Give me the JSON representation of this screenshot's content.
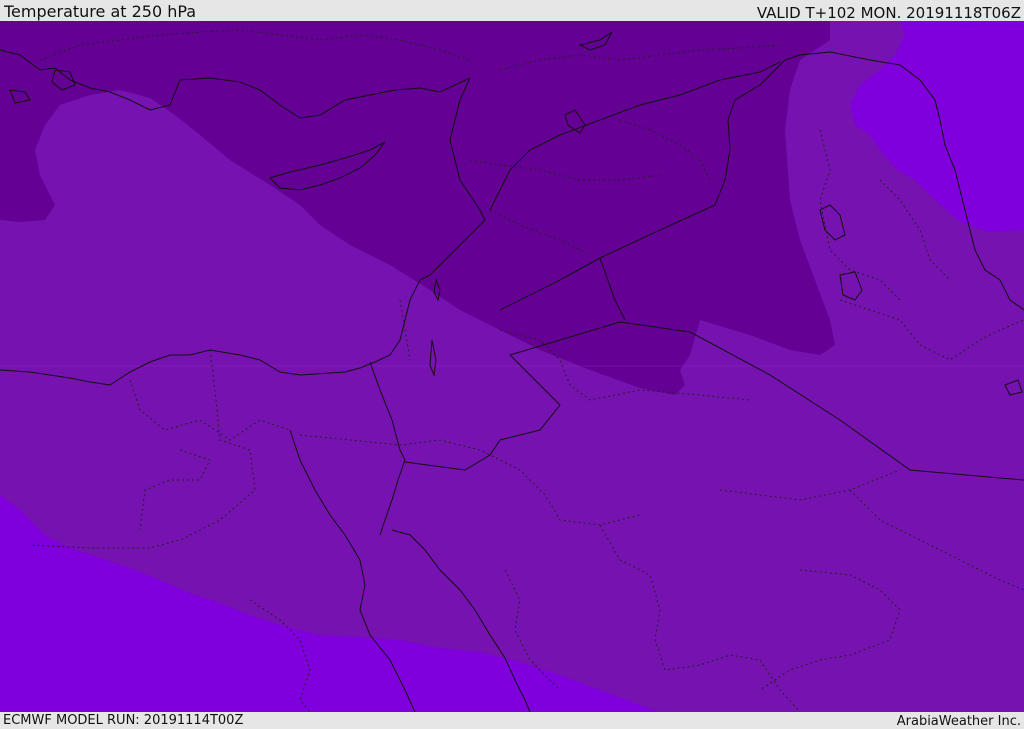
{
  "header": {
    "title": "Temperature at 250 hPa",
    "valid_time": "VALID T+102 MON. 20191118T06Z"
  },
  "footer": {
    "model_run": "ECMWF MODEL RUN: 20191114T00Z",
    "credit": "ArabiaWeather Inc."
  },
  "map": {
    "field": "temperature",
    "level": "250 hPa",
    "colors": {
      "coldest_band": "#650095",
      "mid_band": "#7612b0",
      "warm_band": "#7f00dc",
      "land_outline": "#111111",
      "internal_border": "#222222"
    }
  }
}
